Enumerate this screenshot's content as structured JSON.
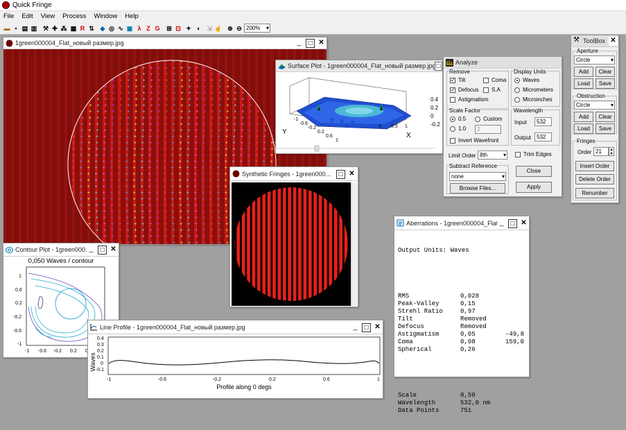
{
  "app": {
    "title": "Quick Fringe"
  },
  "menu": [
    "File",
    "Edit",
    "View",
    "Process",
    "Window",
    "Help"
  ],
  "toolbar": {
    "zoom": "200%"
  },
  "image_window": {
    "title": "1green000004_Flat_новый размер.jpg"
  },
  "surface_window": {
    "title": "Surface Plot - 1green000004_Flat_новый размер.jpg",
    "zticks": [
      "0.4",
      "0.2",
      "0",
      "-0.2"
    ],
    "xticks": [
      "0",
      "0.5",
      "1"
    ],
    "yticks": [
      "-1",
      "-0.6",
      "-0.2",
      "0.2",
      "0.6",
      "1"
    ],
    "xlabel": "X",
    "ylabel": "Y"
  },
  "analyze": {
    "title": "Analyze",
    "remove": {
      "label": "Remove",
      "tilt": "Tilt",
      "coma": "Coma",
      "defocus": "Defocus",
      "sa": "S.A",
      "astig": "Astigmatism"
    },
    "display_units": {
      "label": "Display Units",
      "waves": "Waves",
      "micrometers": "Micrometers",
      "microinches": "Microinches"
    },
    "scale": {
      "label": "Scale Factor",
      "opt1": "0.5",
      "opt2": "1.0",
      "custom": "Custom",
      "custom_value": "2"
    },
    "invert": "Invert Wavefront",
    "wavelength": {
      "label": "Wavelength",
      "input_label": "Input",
      "input": "532",
      "output_label": "Output",
      "output": "532"
    },
    "limit_order_label": "Limit Order",
    "limit_order": "8th",
    "trim": "Trim Edges",
    "subtract": {
      "label": "Subtract Reference",
      "value": "none",
      "browse": "Browse Files..."
    },
    "close": "Close",
    "apply": "Apply"
  },
  "toolbox": {
    "title": "ToolBox",
    "aperture": {
      "label": "Aperture",
      "shape": "Circle",
      "add": "Add",
      "clear": "Clear",
      "load": "Load",
      "save": "Save"
    },
    "obstruction": {
      "label": "Obstruction",
      "shape": "Circle",
      "add": "Add",
      "clear": "Clear",
      "load": "Load",
      "save": "Save"
    },
    "fringes": {
      "label": "Fringes",
      "order_label": "Order",
      "order": "21",
      "insert": "Insert Order",
      "delete": "Delete Order",
      "renumber": "Renumber"
    }
  },
  "synthetic_window": {
    "title": "Synthetic Fringes - 1green000..."
  },
  "aberrations": {
    "title": "Aberrations - 1green000004_Flat...",
    "header": "Output Units: Waves",
    "rows": [
      [
        "RMS",
        "0,028",
        ""
      ],
      [
        "Peak-Valley",
        "0,15",
        ""
      ],
      [
        "Strehl Ratio",
        "0,97",
        ""
      ],
      [
        "Tilt",
        "Removed",
        ""
      ],
      [
        "Defocus",
        "Removed",
        ""
      ],
      [
        "Astigmatism",
        "0,05",
        "-49,8"
      ],
      [
        "Coma",
        "0,08",
        "159,0"
      ],
      [
        "Spherical",
        "0,26",
        ""
      ]
    ],
    "rows2": [
      [
        "Scale",
        "0,50"
      ],
      [
        "Wavelength",
        "532,0 nm"
      ],
      [
        "Data Points",
        "751"
      ]
    ]
  },
  "contour": {
    "title": "Contour Plot - 1green000...",
    "subtitle": "0,050 Waves / contour",
    "yticks": [
      "1",
      "0.6",
      "0.2",
      "-0.2",
      "-0.6",
      "-1"
    ],
    "xticks": [
      "-1",
      "-0.6",
      "-0.2",
      "0.2",
      "0.6"
    ]
  },
  "profile": {
    "title": "Line Profile - 1green000004_Flat_новый размер.jpg",
    "ylabel": "Waves",
    "xlabel": "Profile along 0 degs",
    "yticks": [
      "0.4",
      "0.3",
      "0.2",
      "0.1",
      "0",
      "-0.1"
    ],
    "xticks": [
      "-1",
      "-0.6",
      "-0.2",
      "0.2",
      "0.6",
      "1"
    ]
  }
}
